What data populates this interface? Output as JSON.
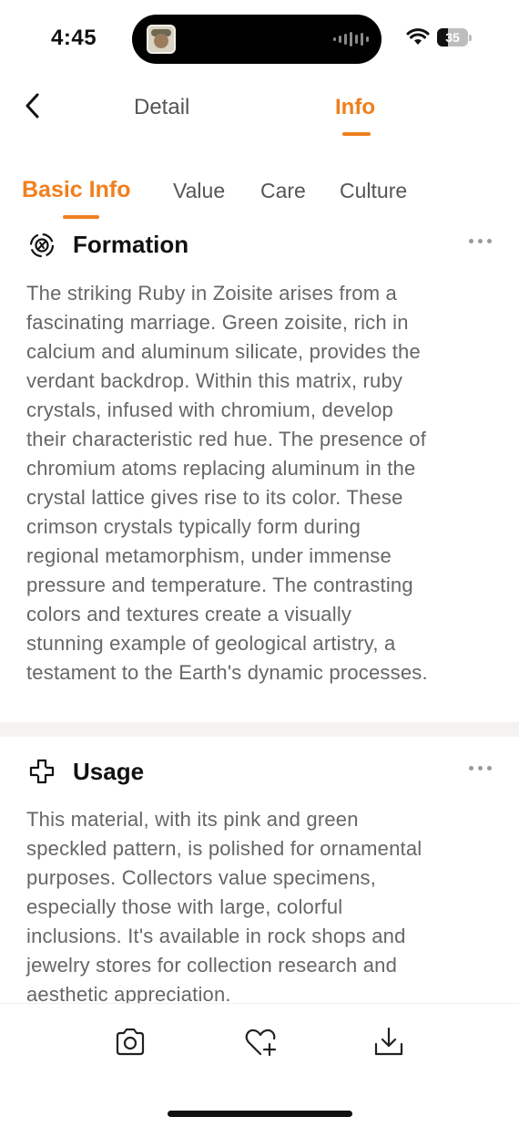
{
  "status_bar": {
    "time": "4:45",
    "battery_level": "35"
  },
  "nav": {
    "tabs": [
      {
        "label": "Detail",
        "active": false
      },
      {
        "label": "Info",
        "active": true
      }
    ]
  },
  "subtabs": [
    {
      "label": "Basic Info",
      "active": true
    },
    {
      "label": "Value",
      "active": false
    },
    {
      "label": "Care",
      "active": false
    },
    {
      "label": "Culture",
      "active": false
    }
  ],
  "sections": [
    {
      "title": "Formation",
      "icon": "formation-icon",
      "lines": [
        "The striking Ruby in Zoisite arises from a",
        "fascinating marriage. Green zoisite, rich in",
        "calcium and aluminum silicate, provides the",
        "verdant backdrop. Within this matrix, ruby",
        "crystals, infused with chromium, develop",
        "their characteristic red hue. The presence of",
        "chromium atoms replacing aluminum in the",
        "crystal lattice gives rise to its color. These",
        "crimson crystals typically form during",
        "regional metamorphism, under immense",
        "pressure and temperature. The contrasting",
        "colors and textures create a visually",
        "stunning example of geological artistry, a",
        "testament to the Earth's dynamic processes."
      ]
    },
    {
      "title": "Usage",
      "icon": "usage-icon",
      "lines": [
        "This material, with its pink and green",
        "speckled pattern, is polished for ornamental",
        "purposes. Collectors value specimens,",
        "especially those with large, colorful",
        "inclusions. It's available in rock shops and",
        "jewelry stores for collection research and",
        "aesthetic appreciation."
      ]
    }
  ],
  "bottom_bar": {
    "buttons": [
      "camera-icon",
      "heart-plus-icon",
      "download-icon"
    ]
  },
  "colors": {
    "accent": "#f07f1d",
    "text": "#666666",
    "title": "#111111"
  }
}
